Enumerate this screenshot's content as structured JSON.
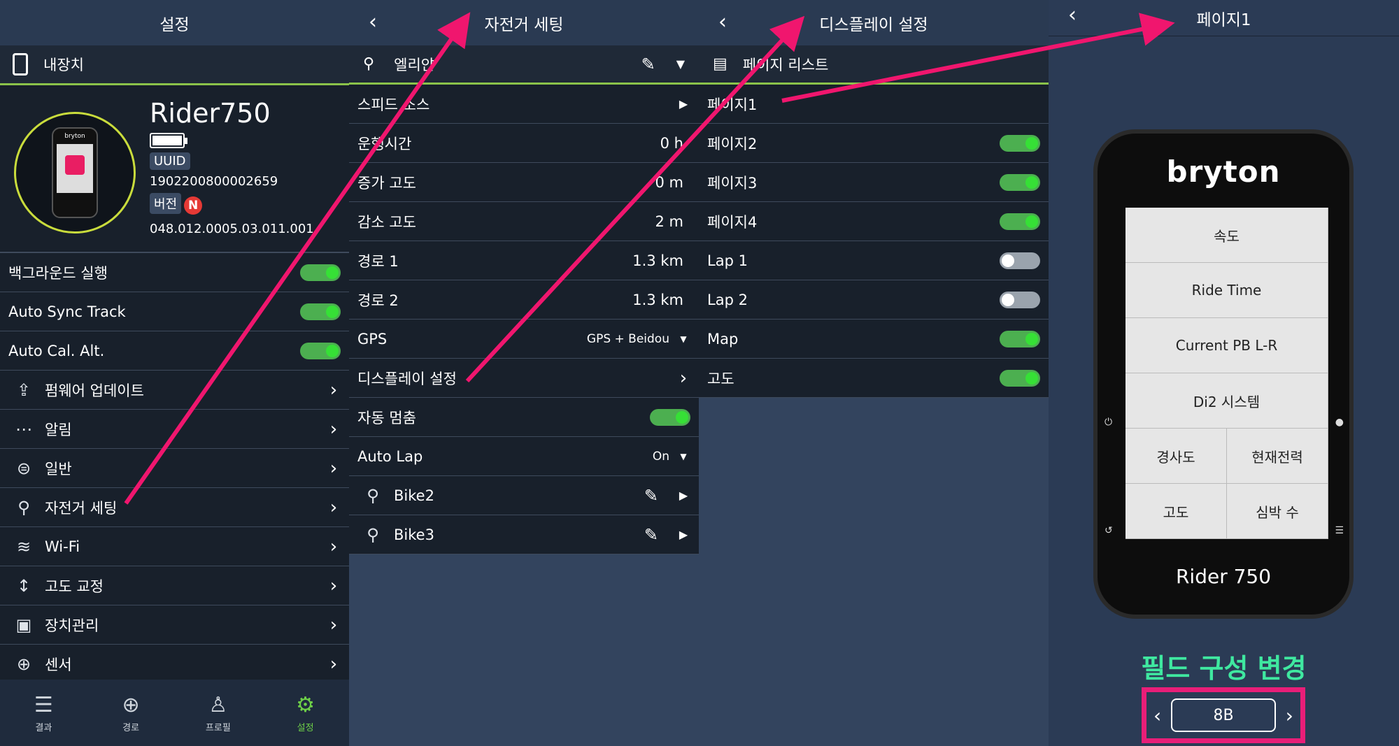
{
  "panel1": {
    "title": "설정",
    "section": "내장치",
    "device": {
      "name": "Rider750",
      "uuid_label": "UUID",
      "uuid": "1902200800002659",
      "version_label": "버전",
      "new_badge": "N",
      "version": "048.012.0005.03.011.001"
    },
    "toggles": [
      {
        "label": "백그라운드 실행",
        "on": true
      },
      {
        "label": "Auto Sync Track",
        "on": true
      },
      {
        "label": "Auto Cal. Alt.",
        "on": true
      }
    ],
    "menu": [
      {
        "label": "펌웨어 업데이트",
        "icon": "firmware-icon"
      },
      {
        "label": "알림",
        "icon": "chat-icon"
      },
      {
        "label": "일반",
        "icon": "general-icon"
      },
      {
        "label": "자전거 세팅",
        "icon": "bike-icon"
      },
      {
        "label": "Wi-Fi",
        "icon": "wifi-icon"
      },
      {
        "label": "고도 교정",
        "icon": "altitude-icon"
      },
      {
        "label": "장치관리",
        "icon": "device-manage-icon"
      },
      {
        "label": "센서",
        "icon": "sensor-icon"
      }
    ],
    "tabs": [
      {
        "label": "결과",
        "icon": "list-icon"
      },
      {
        "label": "경로",
        "icon": "plus-circle-icon"
      },
      {
        "label": "프로필",
        "icon": "profile-icon"
      },
      {
        "label": "설정",
        "icon": "gear-icon",
        "active": true
      }
    ]
  },
  "panel2": {
    "title": "자전거 세팅",
    "bike_name": "엘리얀",
    "rows": [
      {
        "label": "스피드 소스",
        "value": "",
        "type": "arrow"
      },
      {
        "label": "운행시간",
        "value": "0 h",
        "type": "value"
      },
      {
        "label": "증가 고도",
        "value": "0 m",
        "type": "value"
      },
      {
        "label": "감소 고도",
        "value": "2 m",
        "type": "value"
      },
      {
        "label": "경로 1",
        "value": "1.3 km",
        "type": "value"
      },
      {
        "label": "경로 2",
        "value": "1.3 km",
        "type": "value"
      },
      {
        "label": "GPS",
        "value": "GPS + Beidou",
        "type": "dropdown"
      },
      {
        "label": "디스플레이 설정",
        "value": "",
        "type": "chevron"
      },
      {
        "label": "자동 멈춤",
        "value": "",
        "type": "toggle"
      },
      {
        "label": "Auto Lap",
        "value": "On",
        "type": "dropdown"
      }
    ],
    "bikes": [
      "Bike2",
      "Bike3"
    ]
  },
  "panel3": {
    "title": "디스플레이 설정",
    "section": "페이지 리스트",
    "pages": [
      {
        "label": "페이지1",
        "toggle": null
      },
      {
        "label": "페이지2",
        "toggle": true
      },
      {
        "label": "페이지3",
        "toggle": true
      },
      {
        "label": "페이지4",
        "toggle": true
      },
      {
        "label": "Lap 1",
        "toggle": false
      },
      {
        "label": "Lap 2",
        "toggle": false
      },
      {
        "label": "Map",
        "toggle": true
      },
      {
        "label": "고도",
        "toggle": true
      }
    ]
  },
  "panel4": {
    "title": "페이지1",
    "brand": "bryton",
    "model": "Rider 750",
    "fields": [
      "속도",
      "Ride Time",
      "Current PB L-R",
      "Di2 시스템",
      "경사도",
      "현재전력",
      "고도",
      "심박 수"
    ],
    "annotation": "필드 구성 변경",
    "layout_value": "8B"
  },
  "colors": {
    "accent_green": "#4caf50",
    "arrow_pink": "#f0166e",
    "annotation_green": "#3fe8a0"
  }
}
